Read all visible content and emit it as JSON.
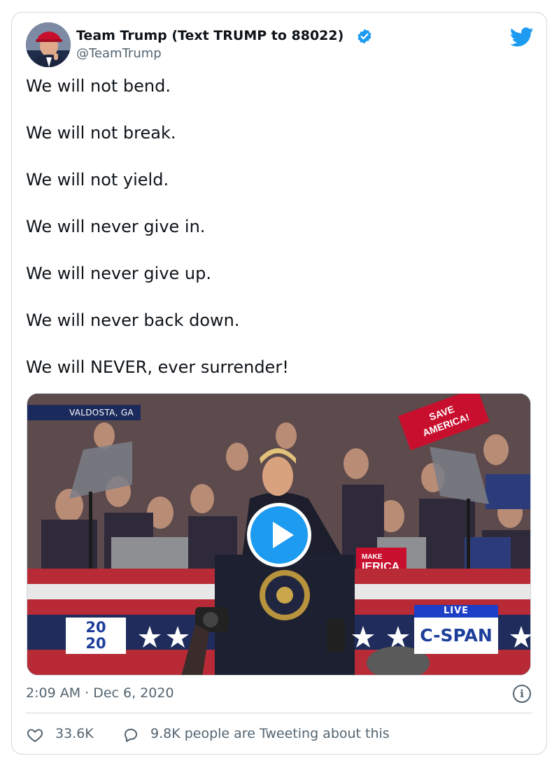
{
  "author": {
    "name": "Team Trump (Text TRUMP to 88022)",
    "handle": "@TeamTrump",
    "verified": true,
    "avatar_icon": "profile-photo"
  },
  "brand": {
    "icon": "twitter-bird-icon",
    "color": "#1d9bf0"
  },
  "tweet": {
    "lines": [
      "We will not bend.",
      "We will not break.",
      "We will not yield.",
      "We will never give in.",
      "We will never give up.",
      "We will never back down.",
      "We will NEVER, ever surrender!"
    ]
  },
  "media": {
    "type": "video",
    "location_overlay": "VALDOSTA, GA",
    "live_label": "LIVE",
    "network_label": "C-SPAN",
    "year_top": "20",
    "year_bottom": "20",
    "sign_save": "SAVE",
    "sign_america": "AMERICA!",
    "sign_make": "MAKE",
    "sign_merica": "IERICA",
    "play_icon": "play-icon"
  },
  "meta": {
    "timestamp": "2:09 AM · Dec 6, 2020",
    "info_icon": "info-icon"
  },
  "actions": {
    "likes": "33.6K",
    "reply_text": "9.8K people are Tweeting about this"
  },
  "colors": {
    "text": "#0f1419",
    "secondary": "#536471",
    "border": "#cfd9de",
    "accent": "#1d9bf0"
  }
}
